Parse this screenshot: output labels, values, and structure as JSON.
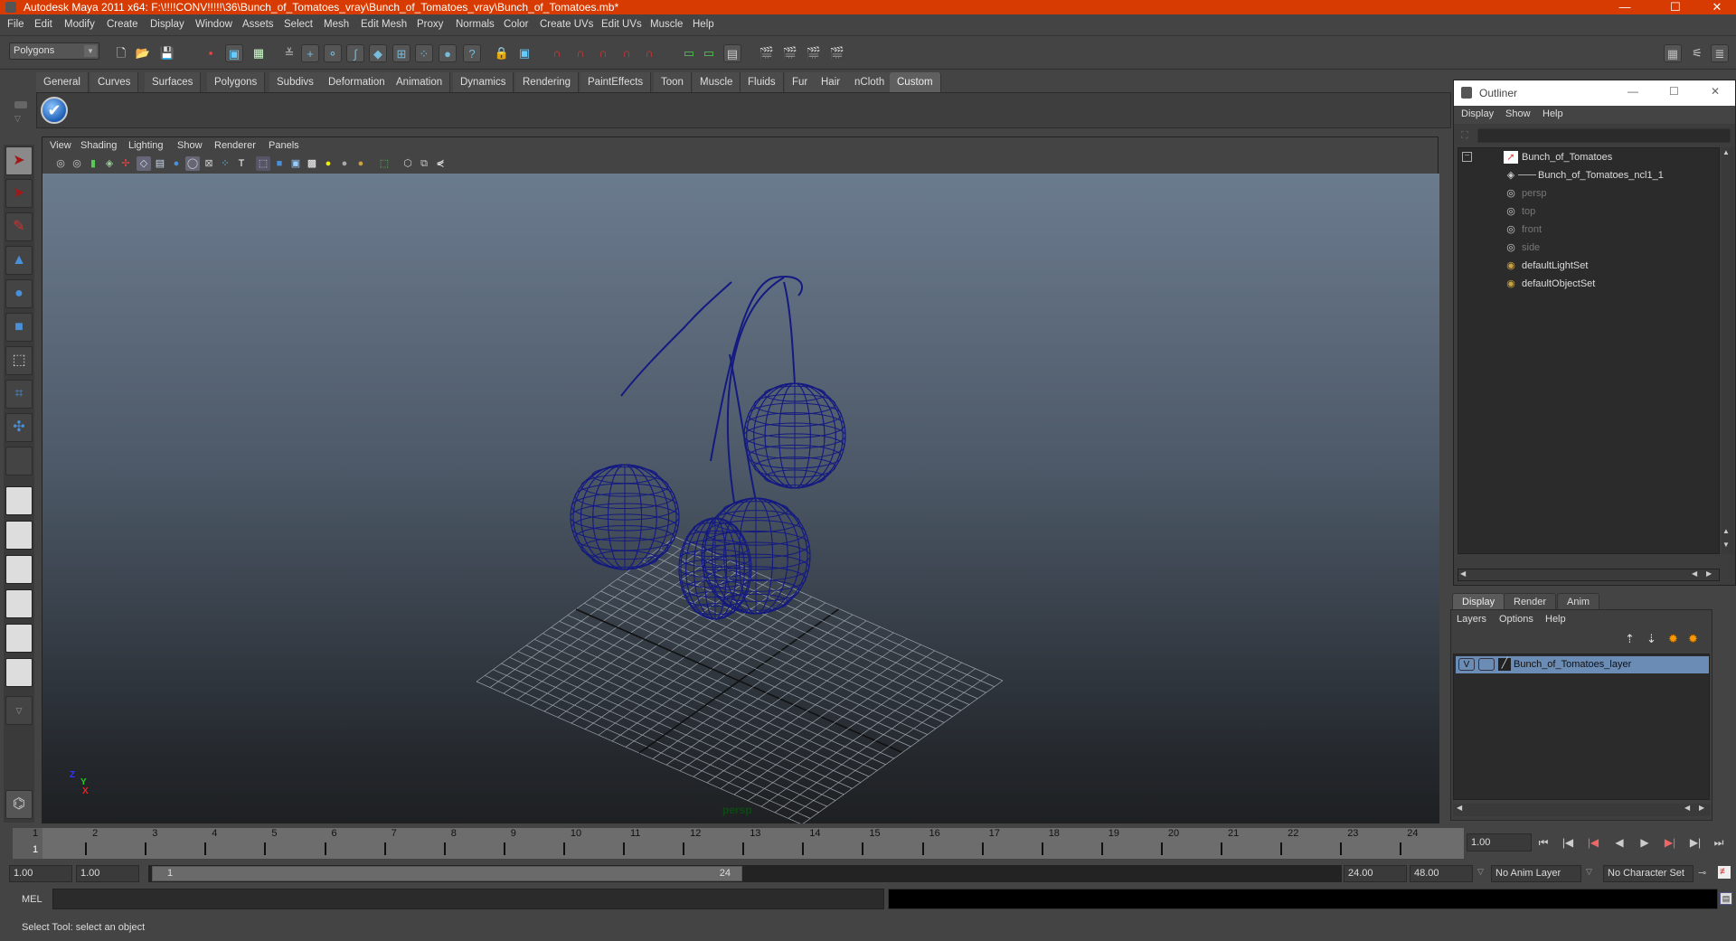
{
  "window": {
    "title": "Autodesk Maya 2011 x64: F:\\!!!!CONV!!!!!\\36\\Bunch_of_Tomatoes_vray\\Bunch_of_Tomatoes_vray\\Bunch_of_Tomatoes.mb*",
    "controls": {
      "minimize": "—",
      "maximize": "☐",
      "close": "✕"
    }
  },
  "menubar": [
    "File",
    "Edit",
    "Modify",
    "Create",
    "Display",
    "Window",
    "Assets",
    "Select",
    "Mesh",
    "Edit Mesh",
    "Proxy",
    "Normals",
    "Color",
    "Create UVs",
    "Edit UVs",
    "Muscle",
    "Help"
  ],
  "toolbar": {
    "mode": "Polygons",
    "icons": [
      "new-scene",
      "open-scene",
      "save-scene",
      "select-by-hierarchy",
      "select-by-object-type",
      "select-by-component-type",
      "mask-menu",
      "select-handles",
      "select-joints",
      "select-curves",
      "select-surfaces",
      "select-deformations",
      "select-dynamics",
      "select-rendering",
      "select-misc",
      "lock-selection",
      "highlight-selection",
      "snap-to-grid",
      "snap-to-curve",
      "snap-to-point",
      "snap-to-view-plane",
      "make-live",
      "history-input",
      "history-output",
      "construction-history",
      "render-current-frame",
      "ipr-render",
      "render-settings",
      "hypershade"
    ]
  },
  "right_toolbar_icons": [
    "attribute-editor",
    "tool-settings",
    "channel-box-layer-editor"
  ],
  "shelf": {
    "tabs": [
      "General",
      "Curves",
      "Surfaces",
      "Polygons",
      "Subdivs",
      "Deformation",
      "Animation",
      "Dynamics",
      "Rendering",
      "PaintEffects",
      "Toon",
      "Muscle",
      "Fluids",
      "Fur",
      "Hair",
      "nCloth",
      "Custom"
    ],
    "active_tab": "Custom",
    "items": [
      "checkmark-script"
    ]
  },
  "toolbox": {
    "tools": [
      "select-tool",
      "lasso-tool",
      "paint-select-tool",
      "move-tool",
      "rotate-tool",
      "scale-tool",
      "universal-manipulator",
      "soft-modification",
      "show-manipulator",
      "last-used-tool"
    ],
    "selected": "select-tool",
    "layouts": [
      "single-perspective",
      "four-view",
      "outliner-persp",
      "persp-graph",
      "hypershade-persp",
      "persp-trax-graph",
      "more-layouts"
    ]
  },
  "viewport": {
    "menu": [
      "View",
      "Shading",
      "Lighting",
      "Show",
      "Renderer",
      "Panels"
    ],
    "camera_label": "persp",
    "axis": {
      "x": "X",
      "y": "Y",
      "z": "Z"
    }
  },
  "outliner": {
    "title": "Outliner",
    "menu": [
      "Display",
      "Show",
      "Help"
    ],
    "items": [
      {
        "label": "Bunch_of_Tomatoes",
        "icon": "transform-icon",
        "dim": false,
        "indent": 0
      },
      {
        "label": "Bunch_of_Tomatoes_ncl1_1",
        "icon": "mesh-icon",
        "dim": false,
        "indent": 1
      },
      {
        "label": "persp",
        "icon": "camera-icon",
        "dim": true,
        "indent": 0
      },
      {
        "label": "top",
        "icon": "camera-icon",
        "dim": true,
        "indent": 0
      },
      {
        "label": "front",
        "icon": "camera-icon",
        "dim": true,
        "indent": 0
      },
      {
        "label": "side",
        "icon": "camera-icon",
        "dim": true,
        "indent": 0
      },
      {
        "label": "defaultLightSet",
        "icon": "set-icon",
        "dim": false,
        "indent": 0
      },
      {
        "label": "defaultObjectSet",
        "icon": "set-icon",
        "dim": false,
        "indent": 0
      }
    ]
  },
  "layer_editor": {
    "tabs": [
      "Display",
      "Render",
      "Anim"
    ],
    "active_tab": "Display",
    "menu": [
      "Layers",
      "Options",
      "Help"
    ],
    "layers": [
      {
        "visible": "V",
        "name": "Bunch_of_Tomatoes_layer"
      }
    ]
  },
  "timeline": {
    "ticks": [
      "1",
      "2",
      "3",
      "4",
      "5",
      "6",
      "7",
      "8",
      "9",
      "10",
      "11",
      "12",
      "13",
      "14",
      "15",
      "16",
      "17",
      "18",
      "19",
      "20",
      "21",
      "22",
      "23",
      "24"
    ],
    "current_frame_marker": "1",
    "current_frame": "1.00",
    "playback": [
      "go-to-start",
      "step-back-key",
      "step-back-frame",
      "play-backwards",
      "play-forwards",
      "step-forward-frame",
      "step-forward-key",
      "go-to-end"
    ]
  },
  "range": {
    "start": "1.00",
    "playback_start": "1.00",
    "slider_start": "1",
    "slider_end": "24",
    "playback_end": "24.00",
    "end": "48.00",
    "anim_layer": "No Anim Layer",
    "character_set": "No Character Set"
  },
  "command_line": {
    "label": "MEL",
    "value": ""
  },
  "status": {
    "help_line": "Select Tool: select an object"
  }
}
